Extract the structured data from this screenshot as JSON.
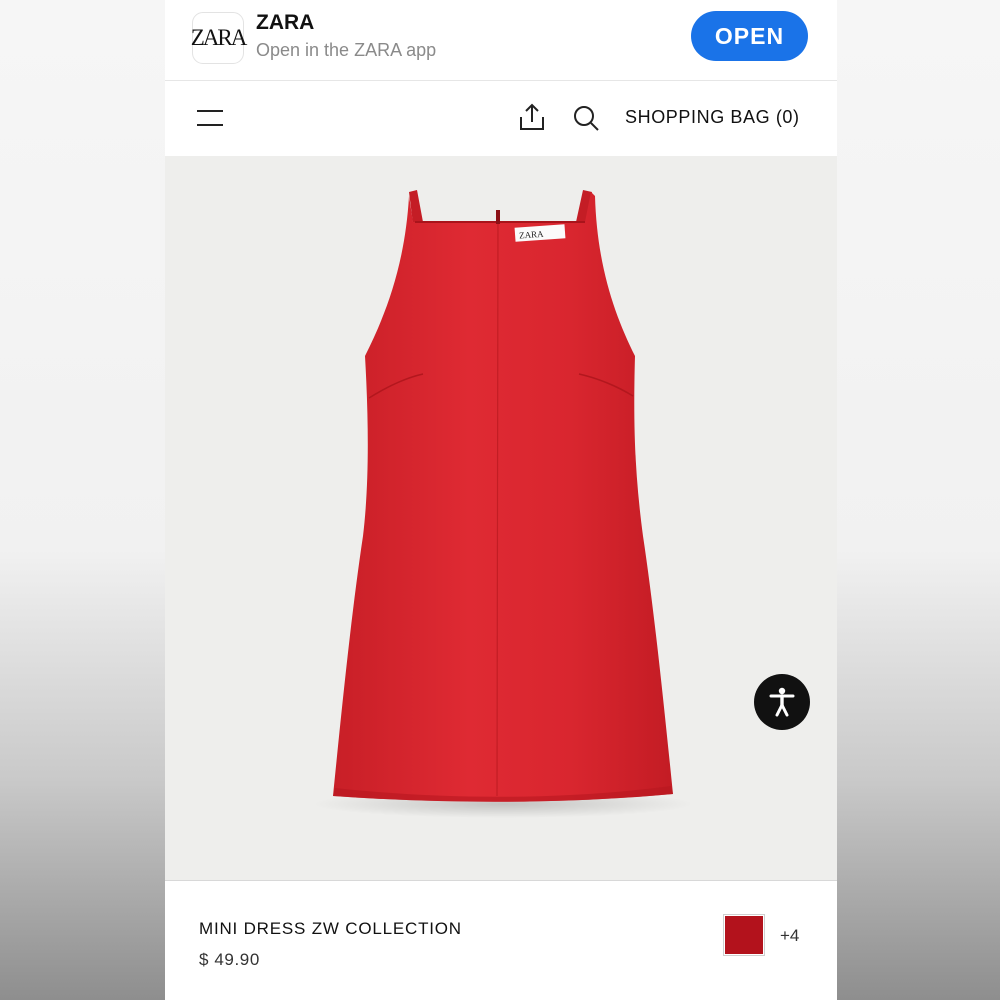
{
  "banner": {
    "app_icon_text": "ZARA",
    "app_name": "ZARA",
    "subtitle": "Open in the ZARA app",
    "open_label": "OPEN",
    "accent_color": "#1a73e8"
  },
  "header": {
    "menu_icon": "hamburger-menu-icon",
    "share_icon": "share-icon",
    "search_icon": "search-icon",
    "bag_label": "SHOPPING BAG (0)"
  },
  "product": {
    "name": "MINI DRESS ZW COLLECTION",
    "price": "$ 49.90",
    "color_swatch": "#b3121c",
    "more_colors": "+4",
    "image_subject": "red sleeveless mini dress",
    "label_text": "ZARA"
  },
  "accessibility": {
    "icon": "accessibility-icon"
  }
}
